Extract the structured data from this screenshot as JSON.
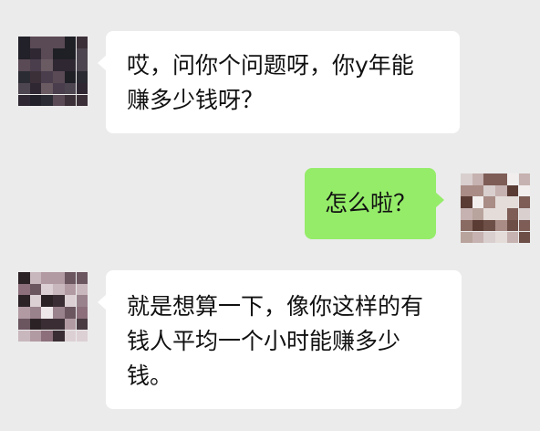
{
  "chat": {
    "messages": [
      {
        "sender": "other",
        "text": "哎，问你个问题呀，你y年能\n赚多少钱呀？"
      },
      {
        "sender": "self",
        "text": "怎么啦？"
      },
      {
        "sender": "other",
        "text": "就是想算一下，像你这样的有\n钱人平均一个小时能赚多少\n钱。"
      }
    ]
  },
  "colors": {
    "background": "#ebebeb",
    "incoming_bubble": "#ffffff",
    "outgoing_bubble": "#95ec69",
    "text": "#111111"
  }
}
